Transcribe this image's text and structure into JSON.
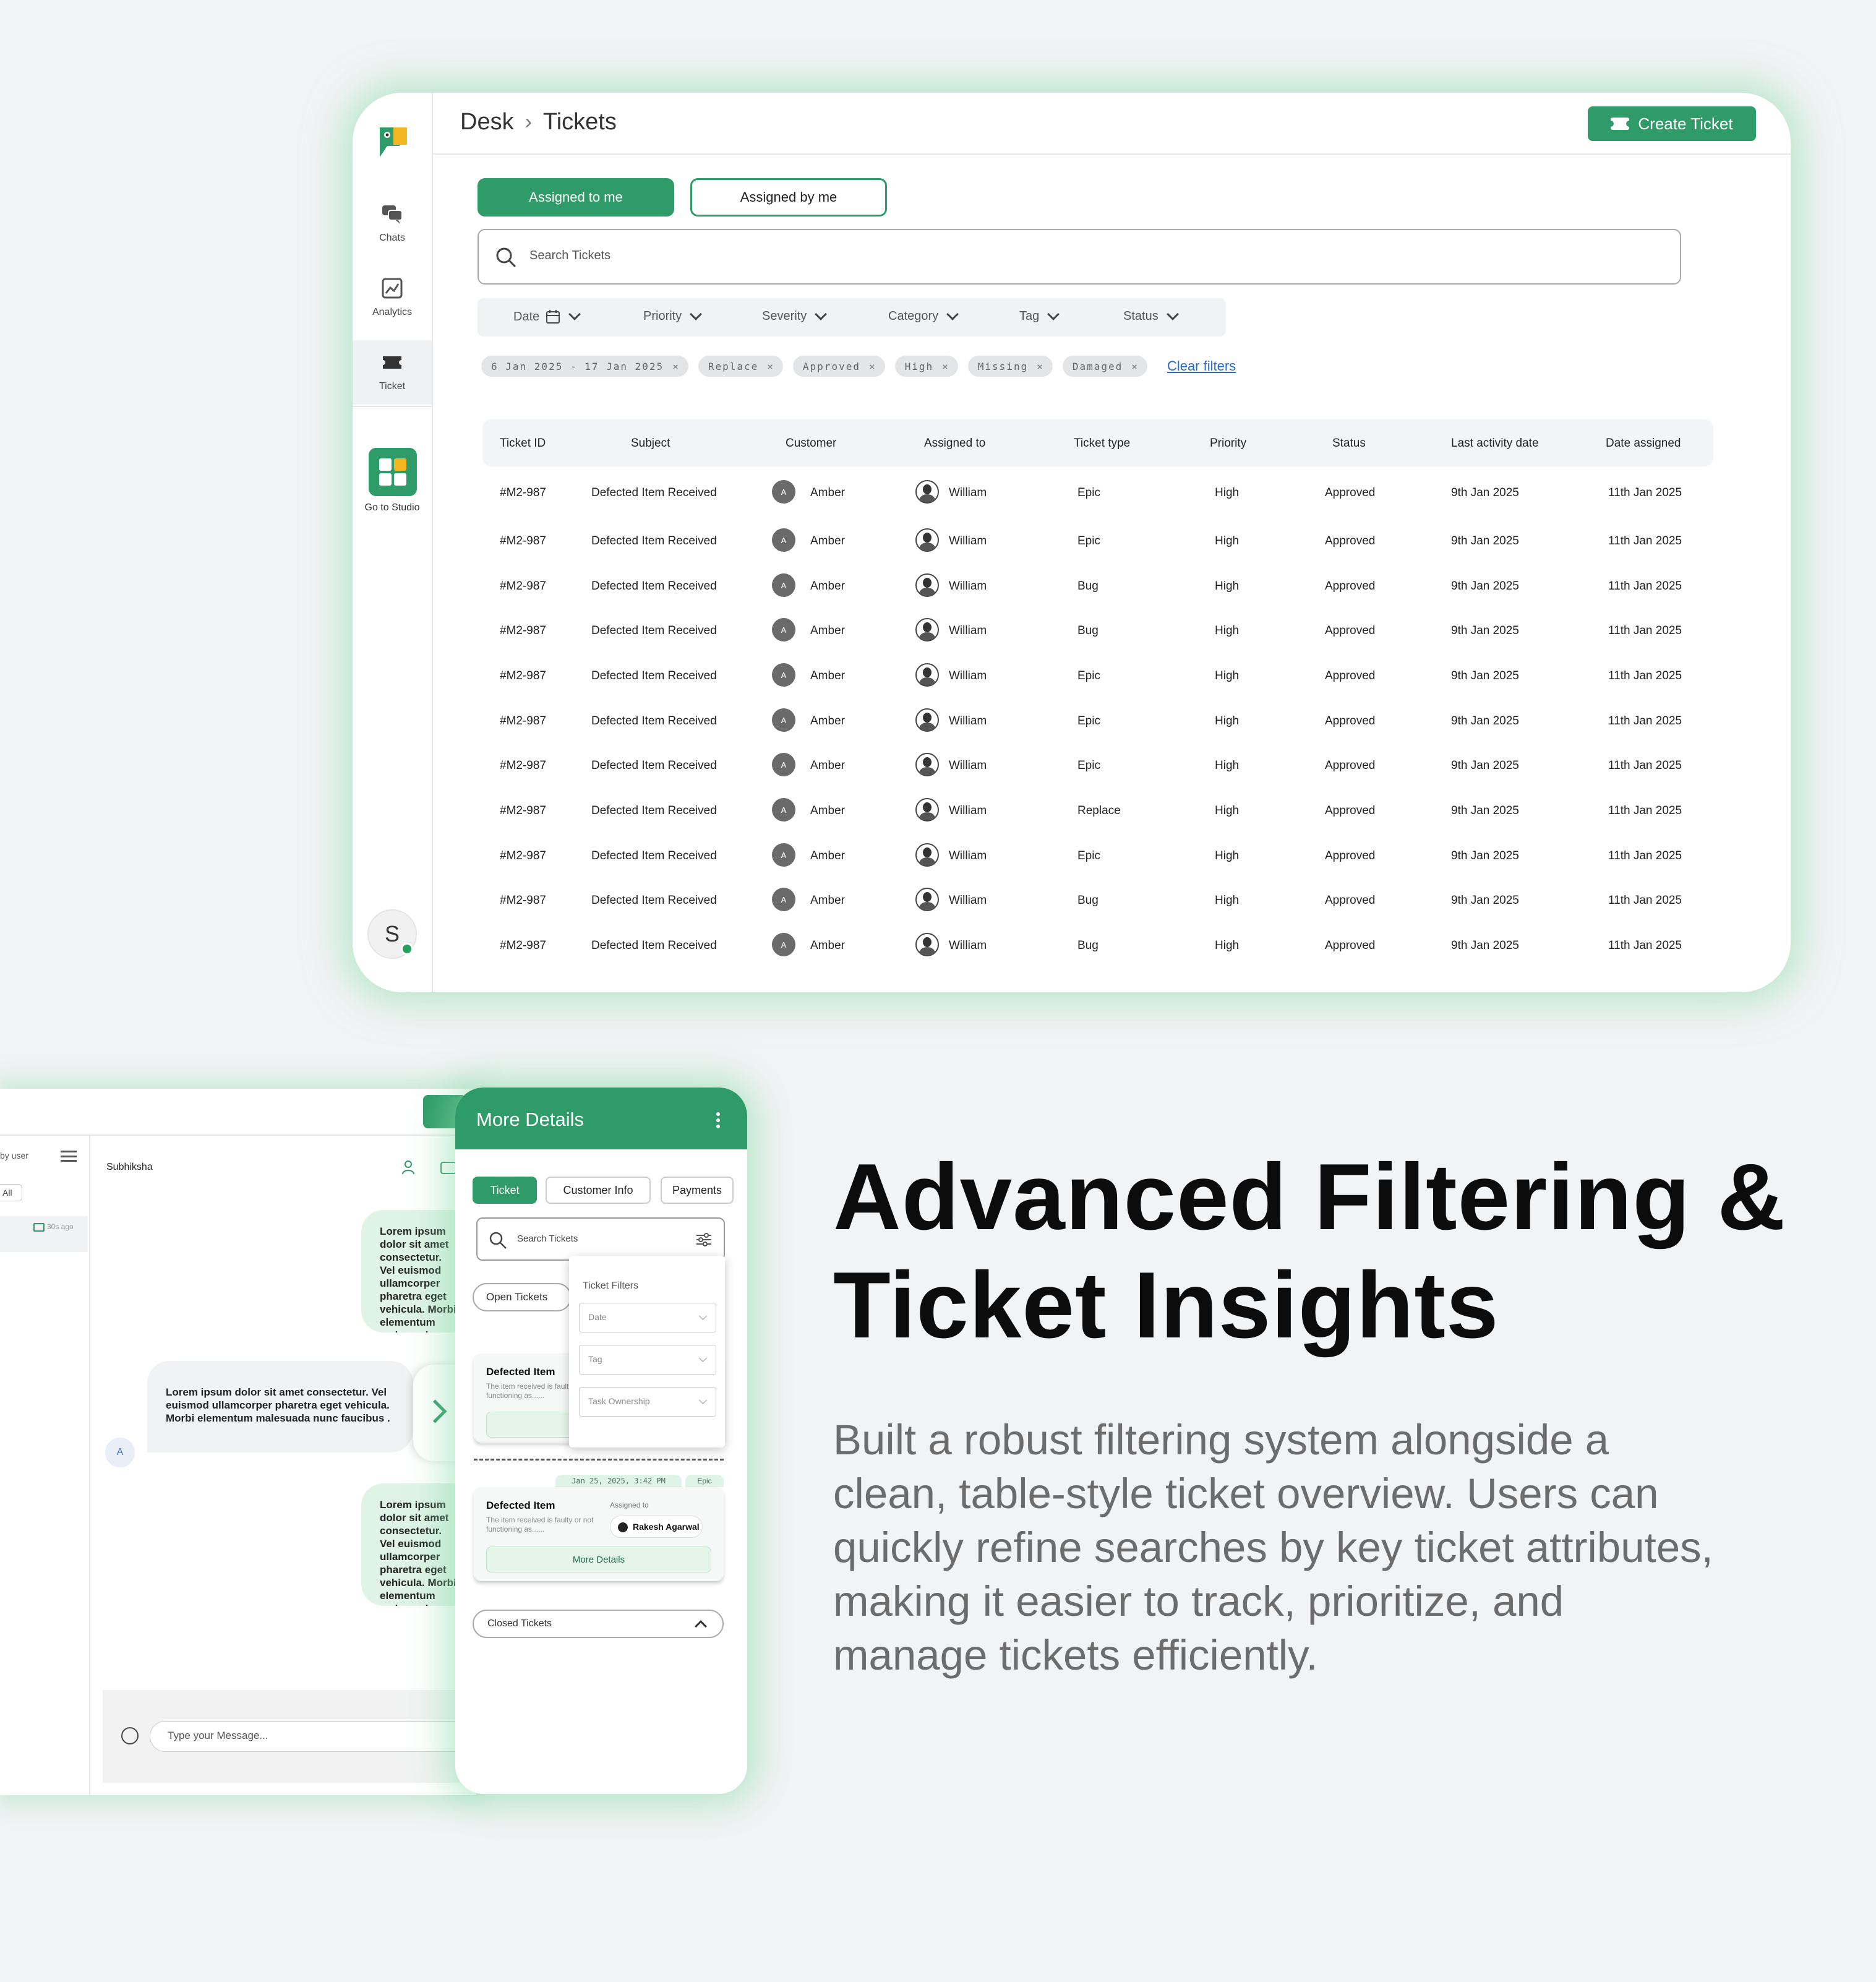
{
  "rail": {
    "items": [
      {
        "label": "Chats"
      },
      {
        "label": "Analytics"
      },
      {
        "label": "Ticket"
      }
    ],
    "studio_label": "Go to Studio",
    "user_initial": "S"
  },
  "header": {
    "crumb_root": "Desk",
    "crumb_sep": "›",
    "crumb_current": "Tickets",
    "create_label": "Create Ticket"
  },
  "tabs": {
    "assigned_to_me": "Assigned to me",
    "assigned_by_me": "Assigned by me"
  },
  "search": {
    "placeholder": "Search Tickets"
  },
  "filters": [
    "Date",
    "Priority",
    "Severity",
    "Category",
    "Tag",
    "Status"
  ],
  "chips": [
    "6 Jan 2025 - 17 Jan 2025",
    "Replace",
    "Approved",
    "High",
    "Missing",
    "Damaged"
  ],
  "clear_filters": "Clear filters",
  "table": {
    "columns": [
      "Ticket ID",
      "Subject",
      "Customer",
      "Assigned to",
      "Ticket type",
      "Priority",
      "Status",
      "Last activity date",
      "Date assigned"
    ],
    "customer_initial": "A",
    "rows": [
      [
        "#M2-987",
        "Defected Item Received",
        "Amber",
        "William",
        "Epic",
        "High",
        "Approved",
        "9th Jan 2025",
        "11th Jan 2025"
      ],
      [
        "#M2-987",
        "Defected Item Received",
        "Amber",
        "William",
        "Epic",
        "High",
        "Approved",
        "9th Jan 2025",
        "11th Jan 2025"
      ],
      [
        "#M2-987",
        "Defected Item Received",
        "Amber",
        "William",
        "Bug",
        "High",
        "Approved",
        "9th Jan 2025",
        "11th Jan 2025"
      ],
      [
        "#M2-987",
        "Defected Item Received",
        "Amber",
        "William",
        "Bug",
        "High",
        "Approved",
        "9th Jan 2025",
        "11th Jan 2025"
      ],
      [
        "#M2-987",
        "Defected Item Received",
        "Amber",
        "William",
        "Epic",
        "High",
        "Approved",
        "9th Jan 2025",
        "11th Jan 2025"
      ],
      [
        "#M2-987",
        "Defected Item Received",
        "Amber",
        "William",
        "Epic",
        "High",
        "Approved",
        "9th Jan 2025",
        "11th Jan 2025"
      ],
      [
        "#M2-987",
        "Defected Item Received",
        "Amber",
        "William",
        "Epic",
        "High",
        "Approved",
        "9th Jan 2025",
        "11th Jan 2025"
      ],
      [
        "#M2-987",
        "Defected Item Received",
        "Amber",
        "William",
        "Replace",
        "High",
        "Approved",
        "9th Jan 2025",
        "11th Jan 2025"
      ],
      [
        "#M2-987",
        "Defected Item Received",
        "Amber",
        "William",
        "Epic",
        "High",
        "Approved",
        "9th Jan 2025",
        "11th Jan 2025"
      ],
      [
        "#M2-987",
        "Defected Item Received",
        "Amber",
        "William",
        "Bug",
        "High",
        "Approved",
        "9th Jan 2025",
        "11th Jan 2025"
      ],
      [
        "#M2-987",
        "Defected Item Received",
        "Amber",
        "William",
        "Bug",
        "High",
        "Approved",
        "9th Jan 2025",
        "11th Jan 2025"
      ]
    ]
  },
  "chat": {
    "by_user": "by user",
    "all": "All",
    "time": "30s ago",
    "contact_name": "Subhiksha",
    "bubble_1": "Lorem ipsum dolor sit amet consectetur. Vel euismod ullamcorper pharetra eget vehicula. Morbi elementum malesuada nunc faucibus adipiscing laoreet eget. Integer malesuada urna urna sed",
    "bubble_2": "Lorem ipsum dolor sit amet consectetur. Vel euismod ullamcorper pharetra eget vehicula. Morbi elementum malesuada nunc faucibus .",
    "bubble_3": "Lorem ipsum dolor sit amet consectetur. Vel euismod ullamcorper pharetra eget vehicula. Morbi elementum malesuada nunc faucibus adipiscing laoreet eget. Integer malesuada urna urna sed",
    "avatar_initial": "A",
    "input_placeholder": "Type your Message..."
  },
  "panel": {
    "title": "More Details",
    "tabs": [
      "Ticket",
      "Customer Info",
      "Payments"
    ],
    "search_placeholder": "Search Tickets",
    "open_tickets": "Open Tickets",
    "card1_title": "Defected Item",
    "card1_desc": "The item received is faulty or not functioning as......",
    "card2_title": "Defected Item",
    "card2_desc": "The item received is faulty or not functioning as......",
    "date_tag": "Jan 25, 2025, 3:42 PM",
    "type_tag": "Epic",
    "assigned_label": "Assigned to",
    "assignee": "Rakesh Agarwal",
    "more_details_btn": "More Details",
    "closed_tickets": "Closed Tickets",
    "filters_title": "Ticket Filters",
    "filter_fields": [
      "Date",
      "Tag",
      "Task Ownership"
    ]
  },
  "headline": "Advanced Filtering & Ticket Insights",
  "body": "Built a robust filtering system alongside a clean, table-style ticket overview. Users can quickly refine searches by key ticket attributes, making it easier to track, prioritize, and manage tickets efficiently.",
  "colors": {
    "brand": "#2e9b68",
    "link": "#2a6cc6",
    "bubble_me": "#dff3e6"
  }
}
